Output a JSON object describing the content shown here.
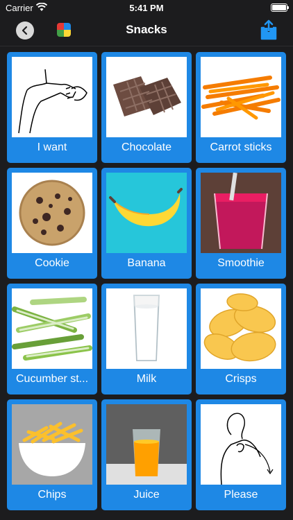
{
  "status_bar": {
    "carrier": "Carrier",
    "time": "5:41 PM"
  },
  "nav": {
    "title": "Snacks"
  },
  "tiles": [
    {
      "label": "I want",
      "icon": "i-want-sign-icon"
    },
    {
      "label": "Chocolate",
      "icon": "chocolate-icon"
    },
    {
      "label": "Carrot sticks",
      "icon": "carrot-sticks-icon"
    },
    {
      "label": "Cookie",
      "icon": "cookie-icon"
    },
    {
      "label": "Banana",
      "icon": "banana-icon"
    },
    {
      "label": "Smoothie",
      "icon": "smoothie-icon"
    },
    {
      "label": "Cucumber st...",
      "icon": "cucumber-sticks-icon"
    },
    {
      "label": "Milk",
      "icon": "milk-icon"
    },
    {
      "label": "Crisps",
      "icon": "crisps-icon"
    },
    {
      "label": "Chips",
      "icon": "chips-icon"
    },
    {
      "label": "Juice",
      "icon": "juice-icon"
    },
    {
      "label": "Please",
      "icon": "please-sign-icon"
    }
  ],
  "colors": {
    "background": "#1c1c1e",
    "tile": "#1e88e5",
    "accent": "#1e88e5"
  }
}
